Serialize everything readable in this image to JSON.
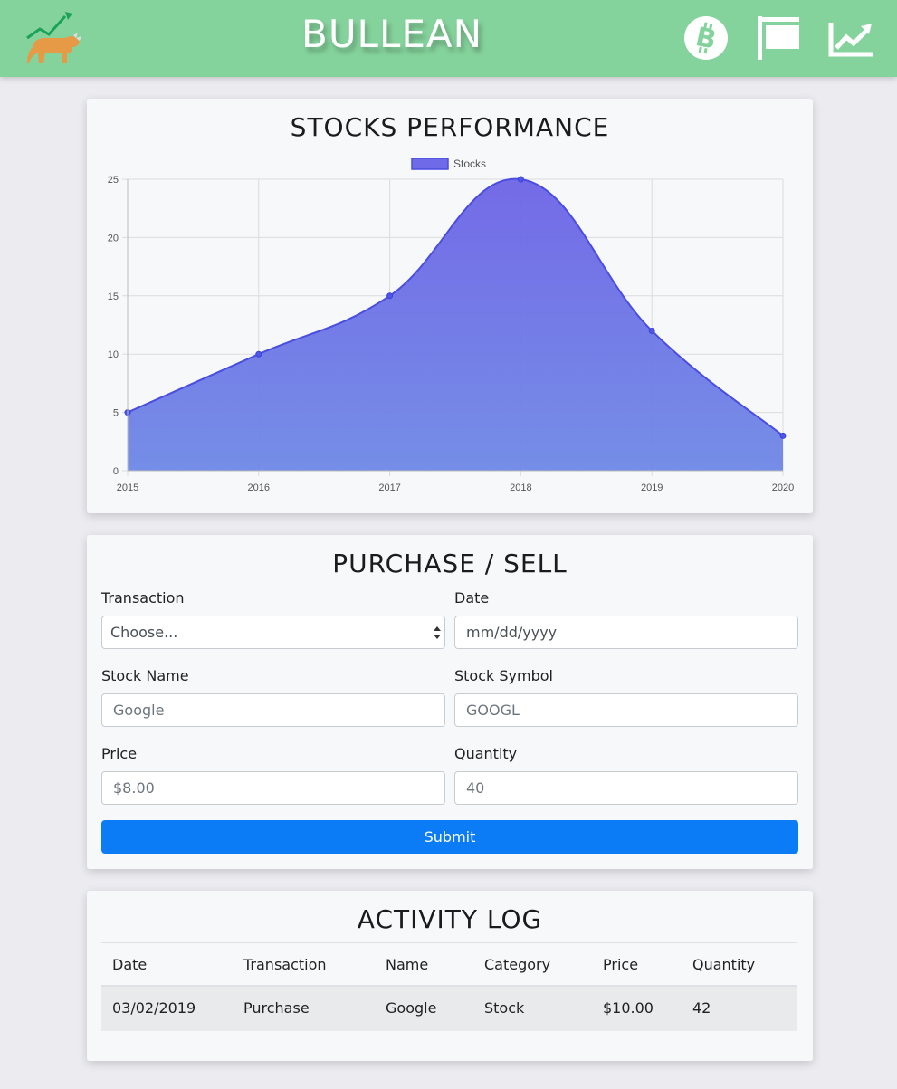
{
  "header": {
    "brand": "BULLEAN",
    "logo_icon": "bull-chart-logo-icon",
    "nav": [
      {
        "icon": "bitcoin-icon",
        "label": "Crypto"
      },
      {
        "icon": "flag-icon",
        "label": "Watchlist"
      },
      {
        "icon": "trending-up-icon",
        "label": "Stocks"
      }
    ],
    "colors": {
      "navbar": "#85d39c",
      "brand_text": "#ffffff"
    }
  },
  "chart_section": {
    "title": "STOCKS PERFORMANCE"
  },
  "chart_data": {
    "type": "area",
    "x": [
      "2015",
      "2016",
      "2017",
      "2018",
      "2019",
      "2020"
    ],
    "series": [
      {
        "name": "Stocks",
        "values": [
          5,
          10,
          15,
          25,
          12,
          3
        ],
        "color": "#6a6ce8"
      }
    ],
    "ylim": [
      0,
      25
    ],
    "yticks": [
      0,
      5,
      10,
      15,
      20,
      25
    ],
    "grid": true,
    "legend_position": "top",
    "curve": "smooth"
  },
  "form": {
    "title": "PURCHASE / SELL",
    "transaction_label": "Transaction",
    "transaction_value": "Choose...",
    "date_label": "Date",
    "date_placeholder": "mm/dd/yyyy",
    "stock_name_label": "Stock Name",
    "stock_name_placeholder": "Google",
    "stock_symbol_label": "Stock Symbol",
    "stock_symbol_placeholder": "GOOGL",
    "price_label": "Price",
    "price_placeholder": "$8.00",
    "quantity_label": "Quantity",
    "quantity_placeholder": "40",
    "submit_label": "Submit",
    "submit_color": "#0b7cf5"
  },
  "activity_log": {
    "title": "ACTIVITY LOG",
    "columns": [
      "Date",
      "Transaction",
      "Name",
      "Category",
      "Price",
      "Quantity"
    ],
    "rows": [
      [
        "03/02/2019",
        "Purchase",
        "Google",
        "Stock",
        "$10.00",
        "42"
      ]
    ]
  }
}
